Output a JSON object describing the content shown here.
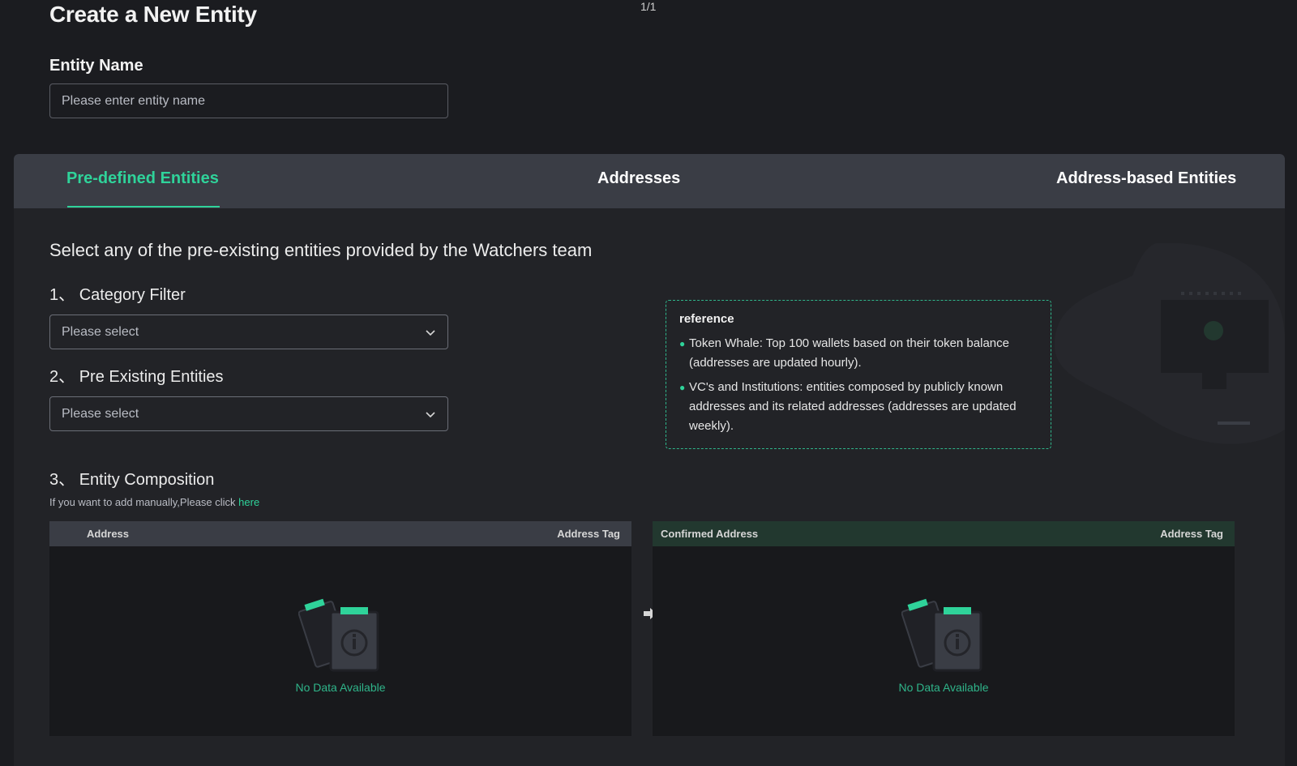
{
  "header": {
    "page_title": "Create a New Entity",
    "top_marker": "1/1",
    "entity_name_label": "Entity Name",
    "entity_name_placeholder": "Please enter entity name",
    "entity_name_value": ""
  },
  "tabs": [
    {
      "label": "Pre-defined Entities",
      "active": true
    },
    {
      "label": "Addresses",
      "active": false
    },
    {
      "label": "Address-based Entities",
      "active": false
    }
  ],
  "predefined": {
    "description": "Select any of the pre-existing entities provided by the Watchers team",
    "step1_num": "1、",
    "step1_label": "Category Filter",
    "step1_placeholder": "Please select",
    "step2_num": "2、",
    "step2_label": "Pre Existing Entities",
    "step2_placeholder": "Please select",
    "step3_num": "3、",
    "step3_label": "Entity Composition",
    "hint_text": "If you want to add manually,Please click ",
    "hint_link": "here"
  },
  "reference": {
    "title": "reference",
    "items": [
      "Token Whale: Top 100 wallets based on their token balance (addresses are updated hourly).",
      "VC's and Institutions: entities composed by publicly known addresses and its related addresses (addresses are updated weekly)."
    ]
  },
  "left_table": {
    "col_address": "Address",
    "col_tag": "Address Tag",
    "empty_text": "No Data Available"
  },
  "right_table": {
    "col_address": "Confirmed Address",
    "col_tag": "Address Tag",
    "empty_text": "No Data Available"
  },
  "icons": {
    "empty_state": "clipboard-info-icon",
    "transfer": "arrow-right-icon",
    "dropdown": "chevron-down-icon"
  },
  "colors": {
    "accent": "#2fd39a",
    "background": "#1b1c20",
    "panel": "#222327",
    "tabbar": "#3a3d45"
  }
}
